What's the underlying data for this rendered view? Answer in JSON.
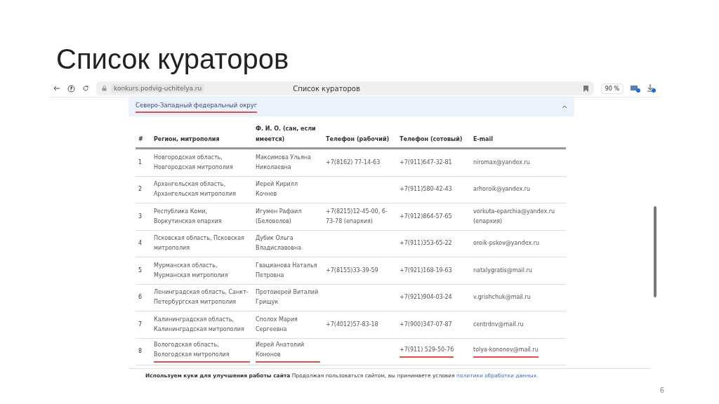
{
  "slide": {
    "title": "Список кураторов",
    "number": "6"
  },
  "browser": {
    "address": "konkurs.podvig-uchitelya.ru",
    "page_title": "Список кураторов",
    "zoom": "90 %"
  },
  "accordion": {
    "title": "Северо-Западный федеральный округ",
    "underlined": true,
    "expanded": true
  },
  "table": {
    "columns": [
      "#",
      "Регион, митрополия",
      "Ф. И. О. (сан, если имеется)",
      "Телефон (рабочий)",
      "Телефон (сотовый)",
      "E-mail"
    ],
    "rows": [
      {
        "cells": [
          "1",
          "Новгородская область, Новгородская митрополия",
          "Максимова Ульяна Николаевна",
          "+7(8162) 77-14-63",
          "+7(911)647-32-81",
          "niromax@yandex.ru"
        ],
        "underlined": false
      },
      {
        "cells": [
          "2",
          "Архангельская область, Архангельская митрополия",
          "Иерей Кирилл Кочнев",
          "",
          "+7(911)580-42-43",
          "arhoroik@yandex.ru"
        ],
        "underlined": false
      },
      {
        "cells": [
          "3",
          "Республика Коми, Воркутинская епархия",
          "Игумен Рафаил (Беловолов)",
          "+7(8215)12-45-00, 6-73-78 (епархия)",
          "+7(912)864-57-65",
          "vorkuta-eparchia@yandex.ru (епархия)"
        ],
        "underlined": false
      },
      {
        "cells": [
          "4",
          "Псковская область, Псковская митрополия",
          "Дубик Ольга Владиславовна",
          "",
          "+7(911)353-65-22",
          "oroik-pskov@yandex.ru"
        ],
        "underlined": false
      },
      {
        "cells": [
          "5",
          "Мурманская область, Мурманская митрополия",
          "Гвацианова Наталья Петровна",
          "+7(8155)33-39-59",
          "+7(921)168-19-63",
          "natalygratis@mail.ru"
        ],
        "underlined": false
      },
      {
        "cells": [
          "6",
          "Ленинградская область, Санкт-Петербургская митрополия",
          "Протоиерей Виталий Грищук",
          "",
          "+7(921)904-03-24",
          "v.grishchuk@mail.ru"
        ],
        "underlined": false
      },
      {
        "cells": [
          "7",
          "Калининградская область, Калининградская митрополия",
          "Сполох Мария Сергеевна",
          "+7(4012)57-83-18",
          "+7(900)347-07-87",
          "centrdnv@mail.ru"
        ],
        "underlined": false
      },
      {
        "cells": [
          "8",
          "Вологодская область, Вологодская митрополия",
          "Иерей Анатолий Кононов",
          "",
          "+7(911) 529-50-76",
          "tolya-kononov@mail.ru"
        ],
        "underlined": true
      }
    ]
  },
  "cookie_bar": {
    "bold": "Используем куки для улучшения работы сайта",
    "text": "Продолжая пользоваться сайтом, вы принимаете условия",
    "link": "политики обработки данных"
  }
}
